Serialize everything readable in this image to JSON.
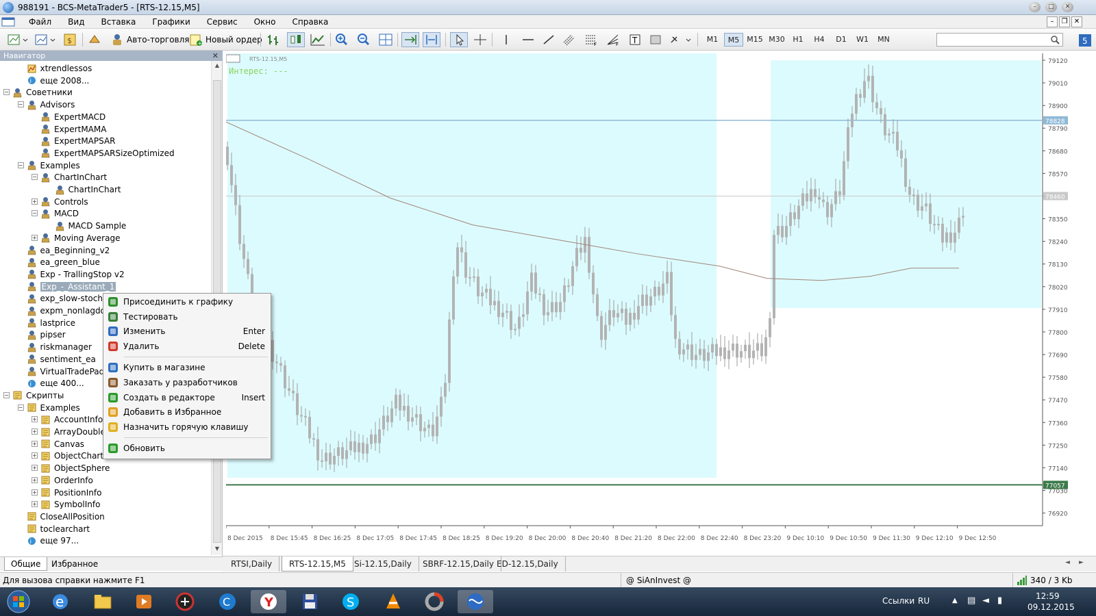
{
  "window": {
    "title": "988191 - BCS-MetaTrader5 - [RTS-12.15,M5]"
  },
  "menu": [
    "Файл",
    "Вид",
    "Вставка",
    "Графики",
    "Сервис",
    "Окно",
    "Справка"
  ],
  "toolbar": {
    "auto_trading": "Авто-торговля",
    "new_order": "Новый ордер",
    "timeframes": [
      "M1",
      "M5",
      "M15",
      "M30",
      "H1",
      "H4",
      "D1",
      "W1",
      "MN"
    ],
    "active_timeframe": "M5"
  },
  "navigator": {
    "title": "Навигатор",
    "tabs": [
      "Общие",
      "Избранное"
    ],
    "active_tab": "Общие",
    "nodes": [
      {
        "label": "xtrendlessos",
        "depth": 2,
        "icon": "indicator",
        "exp": ""
      },
      {
        "label": "еще 2008...",
        "depth": 2,
        "icon": "more",
        "exp": ""
      },
      {
        "label": "Советники",
        "depth": 1,
        "icon": "expert",
        "exp": "-"
      },
      {
        "label": "Advisors",
        "depth": 2,
        "icon": "expert",
        "exp": "-"
      },
      {
        "label": "ExpertMACD",
        "depth": 3,
        "icon": "expert",
        "exp": ""
      },
      {
        "label": "ExpertMAMA",
        "depth": 3,
        "icon": "expert",
        "exp": ""
      },
      {
        "label": "ExpertMAPSAR",
        "depth": 3,
        "icon": "expert",
        "exp": ""
      },
      {
        "label": "ExpertMAPSARSizeOptimized",
        "depth": 3,
        "icon": "expert",
        "exp": ""
      },
      {
        "label": "Examples",
        "depth": 2,
        "icon": "expert",
        "exp": "-"
      },
      {
        "label": "ChartInChart",
        "depth": 3,
        "icon": "expert",
        "exp": "-"
      },
      {
        "label": "ChartInChart",
        "depth": 4,
        "icon": "expert",
        "exp": ""
      },
      {
        "label": "Controls",
        "depth": 3,
        "icon": "expert",
        "exp": "+"
      },
      {
        "label": "MACD",
        "depth": 3,
        "icon": "expert",
        "exp": "-"
      },
      {
        "label": "MACD Sample",
        "depth": 4,
        "icon": "expert",
        "exp": ""
      },
      {
        "label": "Moving Average",
        "depth": 3,
        "icon": "expert",
        "exp": "+"
      },
      {
        "label": "ea_Beginning_v2",
        "depth": 2,
        "icon": "expert",
        "exp": ""
      },
      {
        "label": "ea_green_blue",
        "depth": 2,
        "icon": "expert",
        "exp": ""
      },
      {
        "label": "Exp - TrallingStop v2",
        "depth": 2,
        "icon": "expert",
        "exp": ""
      },
      {
        "label": "Exp_-_Assistant_1",
        "depth": 2,
        "icon": "expert",
        "exp": "",
        "selected": true
      },
      {
        "label": "exp_slow-stoch",
        "depth": 2,
        "icon": "expert",
        "exp": ""
      },
      {
        "label": "expm_nonlagdot",
        "depth": 2,
        "icon": "expert",
        "exp": ""
      },
      {
        "label": "lastprice",
        "depth": 2,
        "icon": "expert",
        "exp": ""
      },
      {
        "label": "pipser",
        "depth": 2,
        "icon": "expert",
        "exp": ""
      },
      {
        "label": "riskmanager",
        "depth": 2,
        "icon": "expert",
        "exp": ""
      },
      {
        "label": "sentiment_ea",
        "depth": 2,
        "icon": "expert",
        "exp": ""
      },
      {
        "label": "VirtualTradePad",
        "depth": 2,
        "icon": "expert",
        "exp": ""
      },
      {
        "label": "еще 400...",
        "depth": 2,
        "icon": "more",
        "exp": ""
      },
      {
        "label": "Скрипты",
        "depth": 1,
        "icon": "script",
        "exp": "-"
      },
      {
        "label": "Examples",
        "depth": 2,
        "icon": "script",
        "exp": "-"
      },
      {
        "label": "AccountInfo",
        "depth": 3,
        "icon": "script",
        "exp": "+"
      },
      {
        "label": "ArrayDouble",
        "depth": 3,
        "icon": "script",
        "exp": "+"
      },
      {
        "label": "Canvas",
        "depth": 3,
        "icon": "script",
        "exp": "+"
      },
      {
        "label": "ObjectChart",
        "depth": 3,
        "icon": "script",
        "exp": "+"
      },
      {
        "label": "ObjectSphere",
        "depth": 3,
        "icon": "script",
        "exp": "+"
      },
      {
        "label": "OrderInfo",
        "depth": 3,
        "icon": "script",
        "exp": "+"
      },
      {
        "label": "PositionInfo",
        "depth": 3,
        "icon": "script",
        "exp": "+"
      },
      {
        "label": "SymbolInfo",
        "depth": 3,
        "icon": "script",
        "exp": "+"
      },
      {
        "label": "CloseAllPosition",
        "depth": 2,
        "icon": "script",
        "exp": ""
      },
      {
        "label": "toclearchart",
        "depth": 2,
        "icon": "script",
        "exp": ""
      },
      {
        "label": "еще 97...",
        "depth": 2,
        "icon": "more",
        "exp": ""
      }
    ]
  },
  "context_menu": {
    "items": [
      {
        "label": "Присоединить к графику",
        "shortcut": "",
        "icon": "chart-attach-icon",
        "color": "#2f8f2f"
      },
      {
        "label": "Тестировать",
        "shortcut": "",
        "icon": "tester-icon",
        "color": "#3a7d3a"
      },
      {
        "label": "Изменить",
        "shortcut": "Enter",
        "icon": "edit-gear-icon",
        "color": "#2f6bbf"
      },
      {
        "label": "Удалить",
        "shortcut": "Delete",
        "icon": "delete-icon",
        "color": "#d03a2a"
      },
      {
        "sep": true
      },
      {
        "label": "Купить в магазине",
        "shortcut": "",
        "icon": "market-icon",
        "color": "#2e6fc0"
      },
      {
        "label": "Заказать у разработчиков",
        "shortcut": "",
        "icon": "briefcase-icon",
        "color": "#8a5a2b"
      },
      {
        "label": "Создать в редакторе",
        "shortcut": "Insert",
        "icon": "create-icon",
        "color": "#2a9a2a"
      },
      {
        "label": "Добавить в Избранное",
        "shortcut": "",
        "icon": "favorite-star-icon",
        "color": "#e0a020"
      },
      {
        "label": "Назначить горячую клавишу",
        "shortcut": "",
        "icon": "hotkey-icon",
        "color": "#e0b020"
      },
      {
        "sep": true
      },
      {
        "label": "Обновить",
        "shortcut": "",
        "icon": "refresh-icon",
        "color": "#2a9a2a"
      }
    ]
  },
  "chart": {
    "symbol_label": "RTS-12.15,M5",
    "interest_label": "Интерес: ---",
    "bid_badge": "78828",
    "ask_badge": "78460",
    "low_badge": "77057",
    "price_ticks": [
      "79120",
      "79010",
      "78900",
      "78790",
      "78680",
      "78570",
      "78460",
      "78350",
      "78240",
      "78130",
      "78020",
      "77910",
      "77800",
      "77690",
      "77580",
      "77470",
      "77360",
      "77250",
      "77140",
      "77030",
      "76920"
    ],
    "time_ticks": [
      "8 Dec 2015",
      "8 Dec 15:45",
      "8 Dec 16:25",
      "8 Dec 17:05",
      "8 Dec 17:45",
      "8 Dec 18:25",
      "8 Dec 19:20",
      "8 Dec 20:00",
      "8 Dec 20:40",
      "8 Dec 21:20",
      "8 Dec 22:00",
      "8 Dec 22:40",
      "8 Dec 23:20",
      "9 Dec 10:10",
      "9 Dec 10:50",
      "9 Dec 11:30",
      "9 Dec 12:10",
      "9 Dec 12:50"
    ],
    "colors": {
      "zone": "#dcfbfe",
      "candle": "#b3b3b3",
      "ma": "#a08478",
      "hline_blue": "#8fb9d6",
      "hline_green": "#3c7a4a"
    }
  },
  "chart_tabs": [
    "RTSI,Daily",
    "RTS-12.15,M5",
    "Si-12.15,Daily",
    "SBRF-12.15,Daily",
    "ED-12.15,Daily"
  ],
  "active_chart_tab": "RTS-12.15,M5",
  "status": {
    "help": "Для вызова справки нажмите F1",
    "profile": "@ SiAnInvest @",
    "traffic": "340 / 3 Kb"
  },
  "taskbar": {
    "links": "Ссылки",
    "lang": "RU",
    "time": "12:59",
    "date": "09.12.2015"
  }
}
